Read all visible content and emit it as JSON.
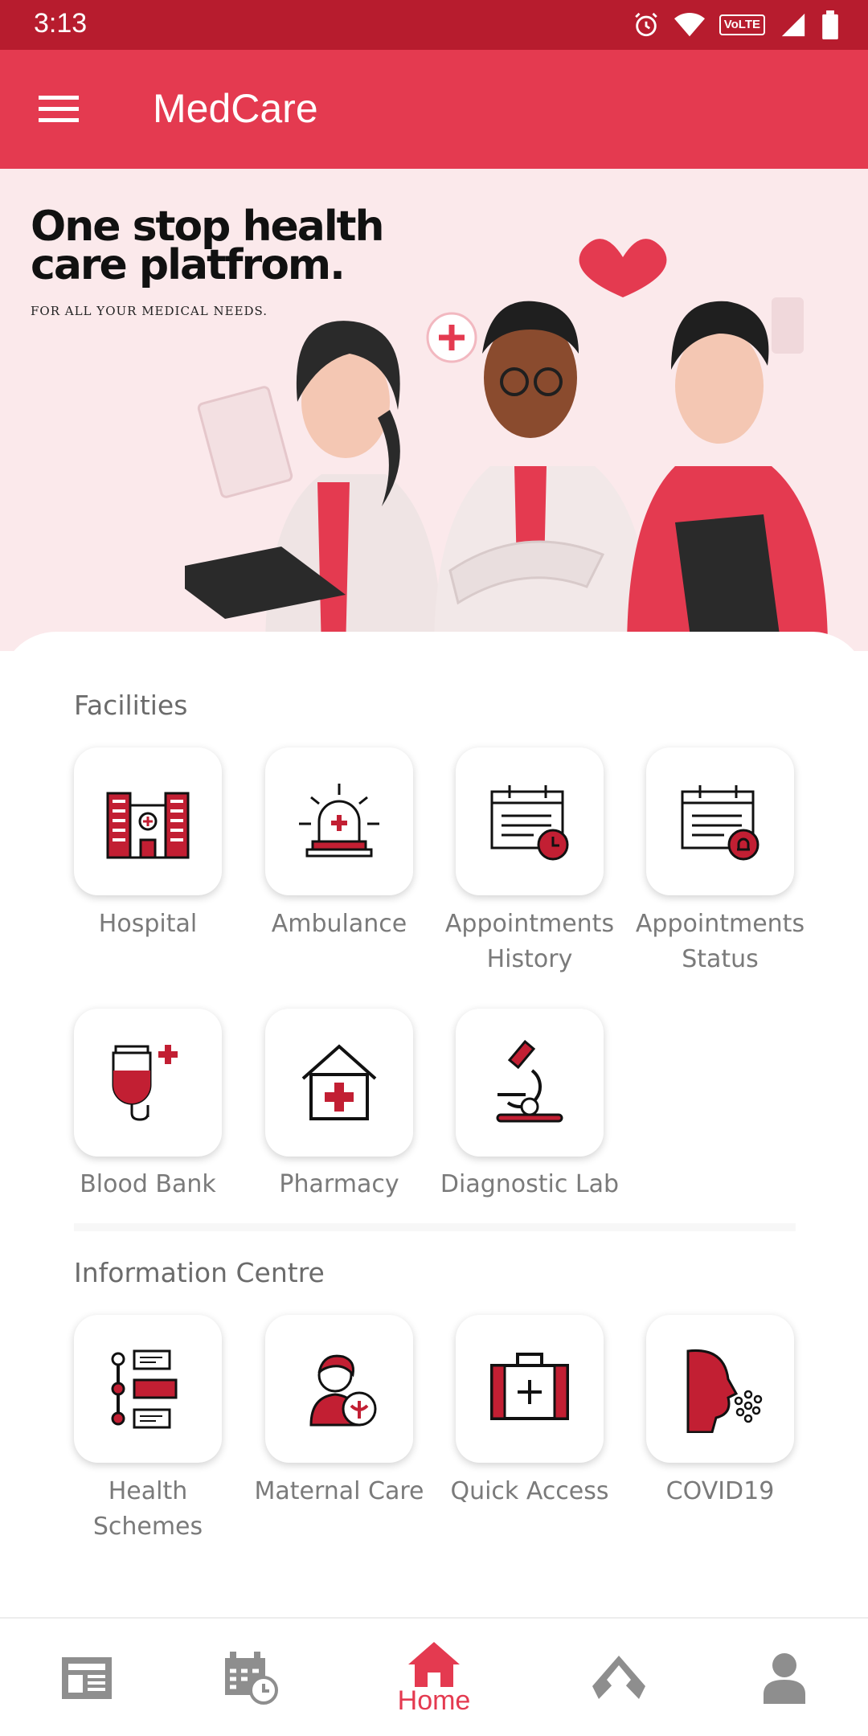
{
  "status": {
    "time": "3:13",
    "network": "VoLTE"
  },
  "app": {
    "title": "MedCare"
  },
  "hero": {
    "title": "One stop health care platfrom.",
    "subtitle": "FOR ALL YOUR MEDICAL NEEDS."
  },
  "facilities": {
    "title": "Facilities",
    "items": [
      {
        "label": "Hospital",
        "icon": "hospital-icon"
      },
      {
        "label": "Ambulance",
        "icon": "ambulance-siren-icon"
      },
      {
        "label": "Appointments History",
        "icon": "appointment-history-icon"
      },
      {
        "label": "Appointments Status",
        "icon": "appointment-status-icon"
      },
      {
        "label": "Blood Bank",
        "icon": "blood-bag-icon"
      },
      {
        "label": "Pharmacy",
        "icon": "pharmacy-house-icon"
      },
      {
        "label": "Diagnostic Lab",
        "icon": "microscope-icon"
      }
    ]
  },
  "info": {
    "title": "Information Centre",
    "items": [
      {
        "label": "Health Schemes",
        "icon": "schemes-list-icon"
      },
      {
        "label": "Maternal Care",
        "icon": "maternal-care-icon"
      },
      {
        "label": "Quick Access",
        "icon": "first-aid-kit-icon"
      },
      {
        "label": "COVID19",
        "icon": "covid-sneeze-icon"
      }
    ]
  },
  "nav": {
    "home_label": "Home",
    "items": [
      "news-icon",
      "calendar-clock-icon",
      "home-icon",
      "ribbon-icon",
      "profile-icon"
    ]
  },
  "colors": {
    "primary": "#e43a50",
    "statusbar": "#b71c2e",
    "icon_red": "#c21f33"
  }
}
